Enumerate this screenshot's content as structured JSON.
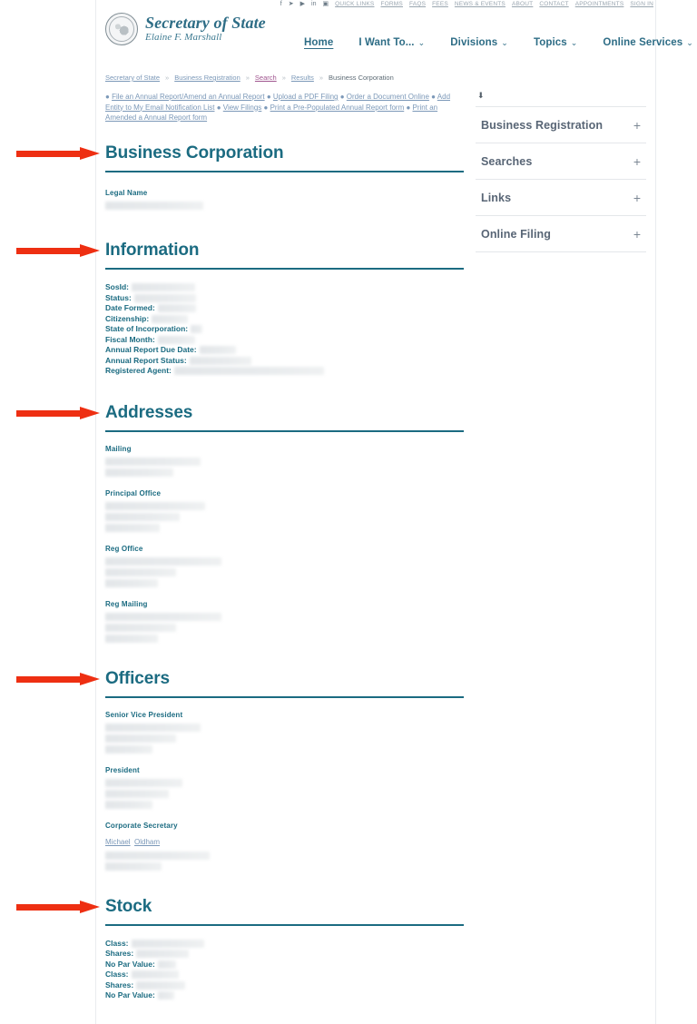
{
  "utility_bar": {
    "icons": [
      "facebook-icon",
      "twitter-icon",
      "youtube-icon",
      "linkedin-icon",
      "instagram-icon"
    ],
    "links": [
      "QUICK LINKS",
      "FORMS",
      "FAQS",
      "FEES",
      "NEWS & EVENTS",
      "ABOUT",
      "CONTACT",
      "APPOINTMENTS",
      "SIGN IN"
    ]
  },
  "header": {
    "brand_title": "Secretary of State",
    "brand_subtitle": "Elaine F. Marshall",
    "seal_icon": "state-seal-icon",
    "nav": [
      {
        "label": "Home",
        "caret": "",
        "active": true
      },
      {
        "label": "I Want To...",
        "caret": "⌄",
        "active": false
      },
      {
        "label": "Divisions",
        "caret": "⌄",
        "active": false
      },
      {
        "label": "Topics",
        "caret": "⌄",
        "active": false
      },
      {
        "label": "Online Services",
        "caret": "⌄",
        "active": false
      }
    ],
    "search_icon": "search-icon"
  },
  "breadcrumb": {
    "items": [
      {
        "label": "Secretary of State",
        "type": "link"
      },
      {
        "label": "Business Registration",
        "type": "link"
      },
      {
        "label": "Search",
        "type": "visited-link"
      },
      {
        "label": "Results",
        "type": "link"
      },
      {
        "label": "Business Corporation",
        "type": "current"
      }
    ],
    "separator": "»"
  },
  "quick_actions": {
    "bullet": "●",
    "links": [
      "File an Annual Report/Amend an Annual Report",
      "Upload a PDF Filing",
      "Order a Document Online",
      "Add Entity to My Email Notification List",
      "View Filings",
      "Print a Pre-Populated Annual Report form",
      "Print an Amended a Annual Report form"
    ]
  },
  "sidebar": {
    "tool_icon": "download-icon",
    "expand_symbol": "+",
    "items": [
      {
        "label": "Business Registration"
      },
      {
        "label": "Searches"
      },
      {
        "label": "Links"
      },
      {
        "label": "Online Filing"
      }
    ]
  },
  "main": {
    "entity_type_heading": "Business Corporation",
    "legal_name_label": "Legal Name",
    "legal_name_value": "",
    "information": {
      "heading": "Information",
      "fields": [
        {
          "label": "SosId:",
          "value": "",
          "redact_width": 70
        },
        {
          "label": "Status:",
          "value": "",
          "redact_width": 68
        },
        {
          "label": "Date Formed:",
          "value": "",
          "redact_width": 42
        },
        {
          "label": "Citizenship:",
          "value": "",
          "redact_width": 40
        },
        {
          "label": "State of Incorporation:",
          "value": "",
          "redact_width": 13
        },
        {
          "label": "Fiscal Month:",
          "value": "",
          "redact_width": 41
        },
        {
          "label": "Annual Report Due Date:",
          "value": "",
          "redact_width": 40
        },
        {
          "label": "Annual Report Status:",
          "value": "",
          "redact_width": 68
        },
        {
          "label": "Registered Agent:",
          "value": "",
          "redact_width": 165
        }
      ]
    },
    "addresses": {
      "heading": "Addresses",
      "blocks": [
        {
          "label": "Mailing",
          "lines": [
            105,
            75
          ]
        },
        {
          "label": "Principal Office",
          "lines": [
            110,
            82,
            60
          ]
        },
        {
          "label": "Reg Office",
          "lines": [
            128,
            78,
            58
          ]
        },
        {
          "label": "Reg Mailing",
          "lines": [
            128,
            78,
            58
          ]
        }
      ]
    },
    "officers": {
      "heading": "Officers",
      "blocks": [
        {
          "title": "Senior Vice President",
          "name_links": [],
          "lines": [
            105,
            78,
            52
          ]
        },
        {
          "title": "President",
          "name_links": [],
          "lines": [
            85,
            70,
            52
          ]
        },
        {
          "title": "Corporate Secretary",
          "name_links": [
            "Michael",
            "Oldham"
          ],
          "lines": [
            115,
            62
          ]
        }
      ]
    },
    "stock": {
      "heading": "Stock",
      "fields": [
        {
          "label": "Class:",
          "value": "",
          "redact_width": 80
        },
        {
          "label": "Shares:",
          "value": "",
          "redact_width": 58
        },
        {
          "label": "No Par Value:",
          "value": "",
          "redact_width": 20
        },
        {
          "label": "Class:",
          "value": "",
          "redact_width": 52
        },
        {
          "label": "Shares:",
          "value": "",
          "redact_width": 54
        },
        {
          "label": "No Par Value:",
          "value": "",
          "redact_width": 18
        }
      ]
    }
  },
  "annotations": {
    "color": "#ee2f12",
    "arrows": [
      {
        "target": "Business Corporation"
      },
      {
        "target": "Information"
      },
      {
        "target": "Addresses"
      },
      {
        "target": "Officers"
      },
      {
        "target": "Stock"
      }
    ]
  },
  "theme": {
    "heading_color": "#1b6b81",
    "link_color": "#7b98b8",
    "visited_link_color": "#a0558f",
    "sidebar_label_color": "#586575",
    "arrow_color": "#ee2f12"
  }
}
